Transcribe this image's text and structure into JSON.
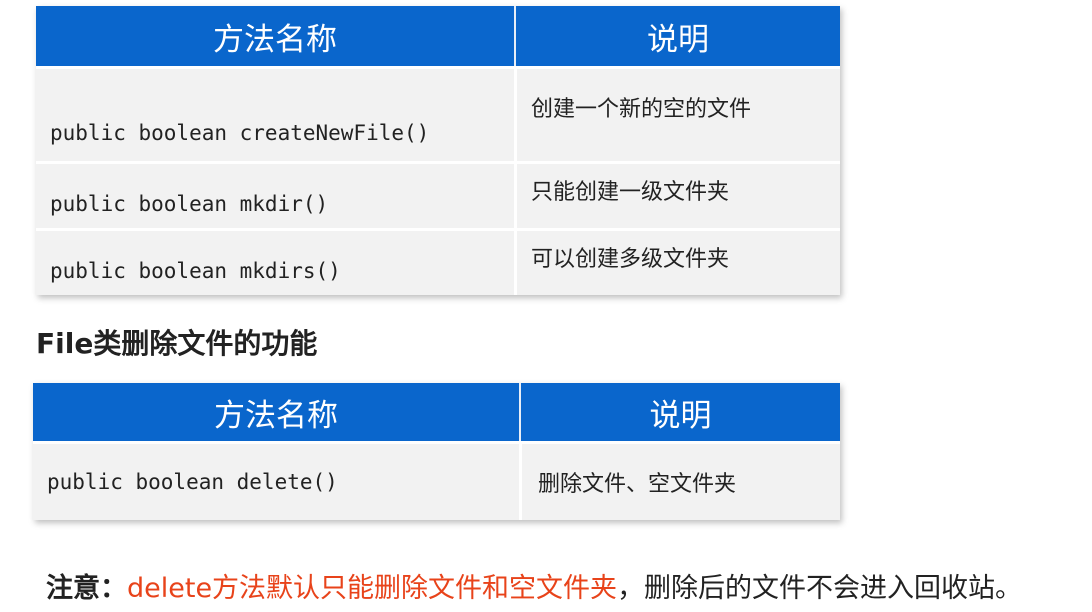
{
  "table1": {
    "headers": [
      "方法名称",
      "说明"
    ],
    "rows": [
      {
        "method": "public boolean createNewFile()",
        "desc": "创建一个新的空的文件"
      },
      {
        "method": "public boolean mkdir()",
        "desc": "只能创建一级文件夹"
      },
      {
        "method": "public boolean mkdirs()",
        "desc": "可以创建多级文件夹"
      }
    ]
  },
  "section_title": "File类删除文件的功能",
  "table2": {
    "headers": [
      "方法名称",
      "说明"
    ],
    "rows": [
      {
        "method": "public boolean delete()",
        "desc": "删除文件、空文件夹"
      }
    ]
  },
  "note": {
    "label": "注意：",
    "highlight": "delete方法默认只能删除文件和空文件夹",
    "rest": "，删除后的文件不会进入回收站。"
  },
  "colors": {
    "header_bg": "#0a66cc",
    "row_bg": "#f2f2f2",
    "highlight_text": "#e8431a"
  }
}
